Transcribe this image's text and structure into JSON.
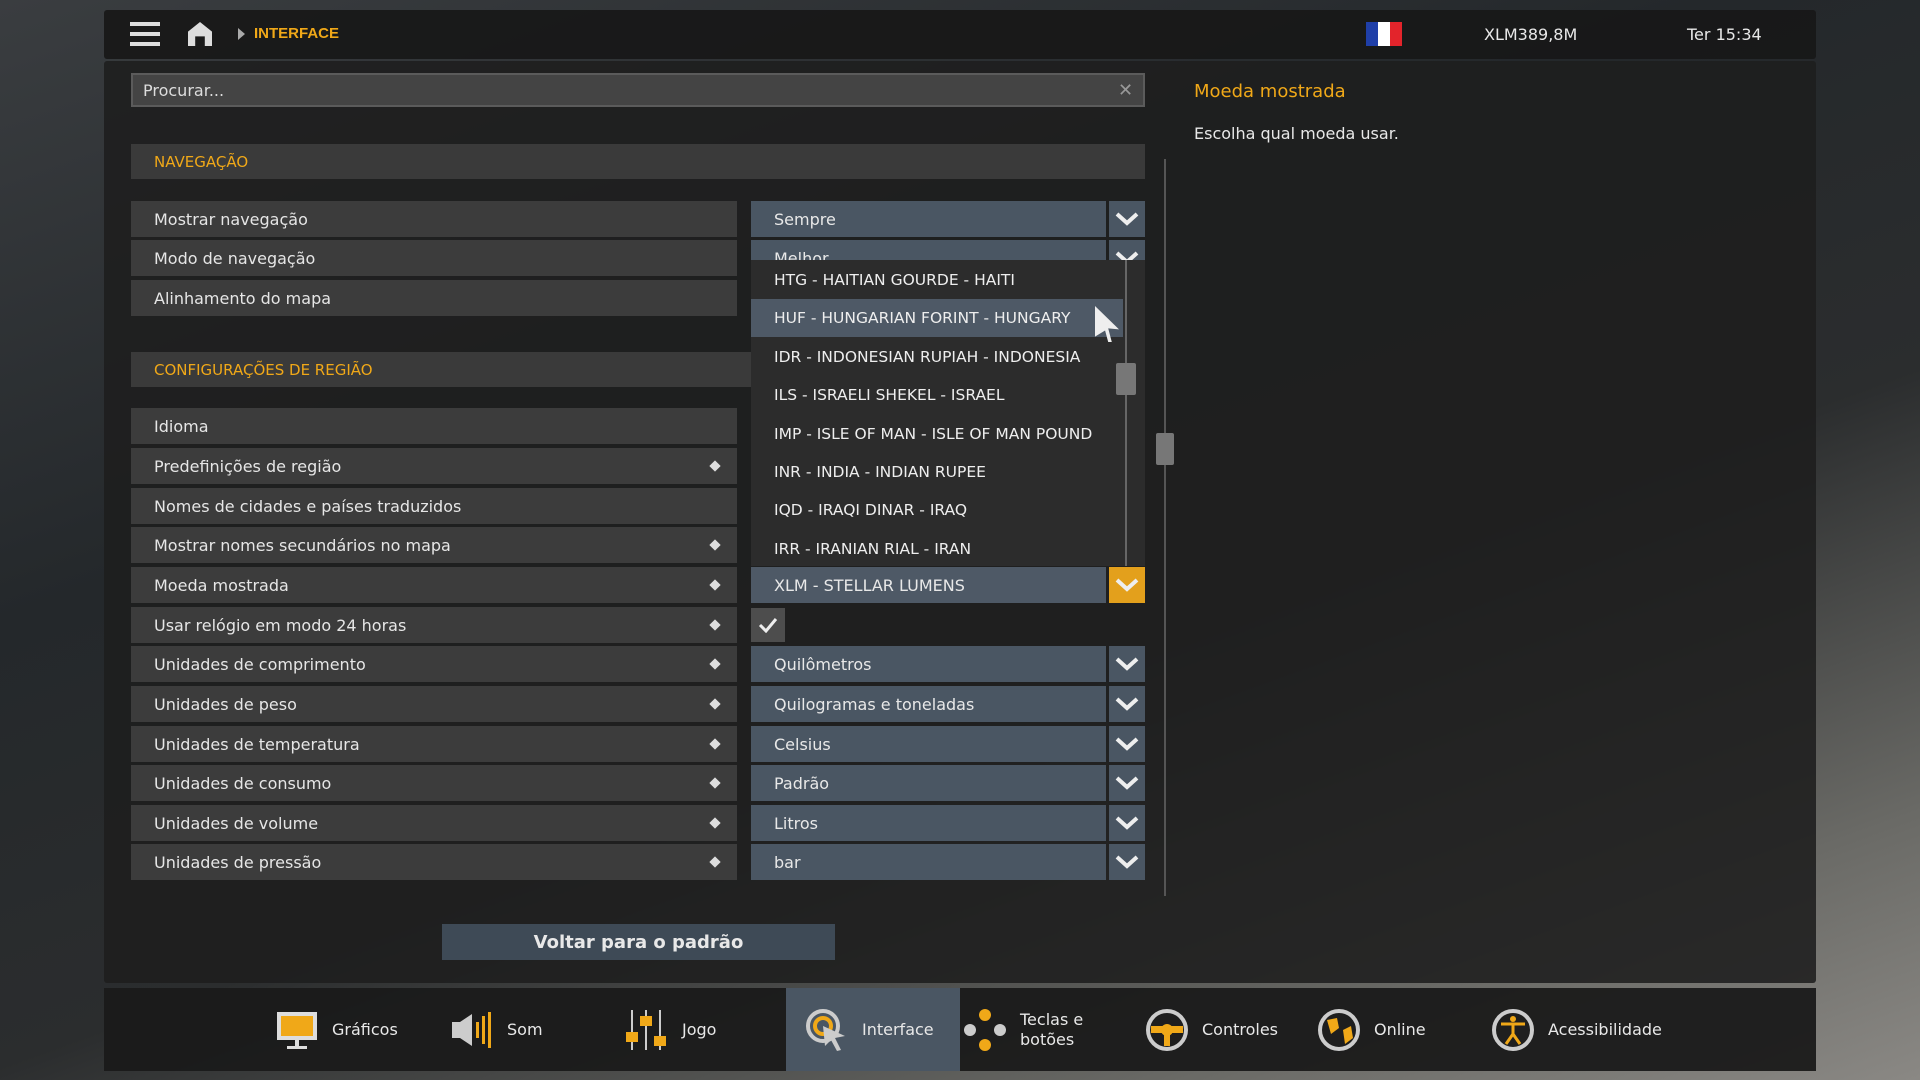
{
  "header": {
    "breadcrumb": "INTERFACE",
    "money": "XLM389,8M",
    "clock": "Ter 15:34"
  },
  "search": {
    "placeholder": "Procurar..."
  },
  "info": {
    "title": "Moeda mostrada",
    "description": "Escolha qual moeda usar."
  },
  "sections": {
    "nav": "NAVEGAÇÃO",
    "region": "CONFIGURAÇÕES DE REGIÃO"
  },
  "nav_rows": [
    {
      "label": "Mostrar navegação",
      "value": "Sempre"
    },
    {
      "label": "Modo de navegação",
      "value": "Melhor"
    },
    {
      "label": "Alinhamento do mapa"
    }
  ],
  "region_rows": [
    {
      "label": "Idioma"
    },
    {
      "label": "Predefinições de região"
    },
    {
      "label": "Nomes de cidades e países traduzidos"
    },
    {
      "label": "Mostrar nomes secundários no mapa"
    },
    {
      "label": "Moeda mostrada",
      "value": "XLM - STELLAR LUMENS"
    },
    {
      "label": "Usar relógio em modo 24 horas",
      "checked": true
    },
    {
      "label": "Unidades de comprimento",
      "value": "Quilômetros"
    },
    {
      "label": "Unidades de peso",
      "value": "Quilogramas e toneladas"
    },
    {
      "label": "Unidades de temperatura",
      "value": "Celsius"
    },
    {
      "label": "Unidades de consumo",
      "value": "Padrão"
    },
    {
      "label": "Unidades de volume",
      "value": "Litros"
    },
    {
      "label": "Unidades de pressão",
      "value": "bar"
    }
  ],
  "currency_options": [
    "HTG - HAITIAN GOURDE - HAITI",
    "HUF - HUNGARIAN FORINT - HUNGARY",
    "IDR - INDONESIAN RUPIAH - INDONESIA",
    "ILS - ISRAELI SHEKEL - ISRAEL",
    "IMP - ISLE OF MAN - ISLE OF MAN POUND",
    "INR - INDIA - INDIAN RUPEE",
    "IQD - IRAQI DINAR - IRAQ",
    "IRR - IRANIAN RIAL - IRAN"
  ],
  "reset_label": "Voltar para o padrão",
  "tabs": [
    {
      "label": "Gráficos",
      "icon": "monitor-icon"
    },
    {
      "label": "Som",
      "icon": "speaker-icon"
    },
    {
      "label": "Jogo",
      "icon": "sliders-icon"
    },
    {
      "label": "Interface",
      "icon": "cursor-icon"
    },
    {
      "label": "Teclas e botões",
      "icon": "buttons-icon"
    },
    {
      "label": "Controles",
      "icon": "steering-wheel-icon"
    },
    {
      "label": "Online",
      "icon": "globe-icon"
    },
    {
      "label": "Acessibilidade",
      "icon": "accessibility-icon"
    }
  ],
  "colors": {
    "accent": "#f0a818",
    "select": "#4a5663"
  }
}
